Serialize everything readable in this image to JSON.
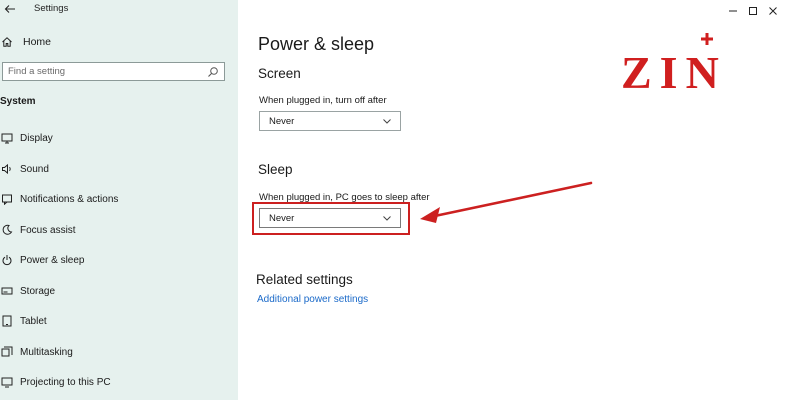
{
  "window": {
    "app_title": "Settings",
    "controls": {
      "minimize_icon": "minimize-icon",
      "maximize_icon": "maximize-icon",
      "close_icon": "close-icon"
    }
  },
  "sidebar": {
    "home_label": "Home",
    "search_placeholder": "Find a setting",
    "section_title": "System",
    "items": [
      {
        "label": "Display",
        "icon": "monitor-icon"
      },
      {
        "label": "Sound",
        "icon": "speaker-icon"
      },
      {
        "label": "Notifications & actions",
        "icon": "notification-icon"
      },
      {
        "label": "Focus assist",
        "icon": "moon-icon"
      },
      {
        "label": "Power & sleep",
        "icon": "power-icon"
      },
      {
        "label": "Storage",
        "icon": "storage-icon"
      },
      {
        "label": "Tablet",
        "icon": "tablet-icon"
      },
      {
        "label": "Multitasking",
        "icon": "multitasking-icon"
      },
      {
        "label": "Projecting to this PC",
        "icon": "projector-icon"
      }
    ]
  },
  "main": {
    "page_title": "Power & sleep",
    "screen": {
      "heading": "Screen",
      "label": "When plugged in, turn off after",
      "value": "Never"
    },
    "sleep": {
      "heading": "Sleep",
      "label": "When plugged in, PC goes to sleep after",
      "value": "Never"
    },
    "related": {
      "heading": "Related settings",
      "link": "Additional power settings"
    },
    "logo_text": "ZIN"
  },
  "colors": {
    "sidebar_bg": "#e6f1ee",
    "accent_link": "#1b6ac9",
    "annotation_red": "#cc2020"
  }
}
